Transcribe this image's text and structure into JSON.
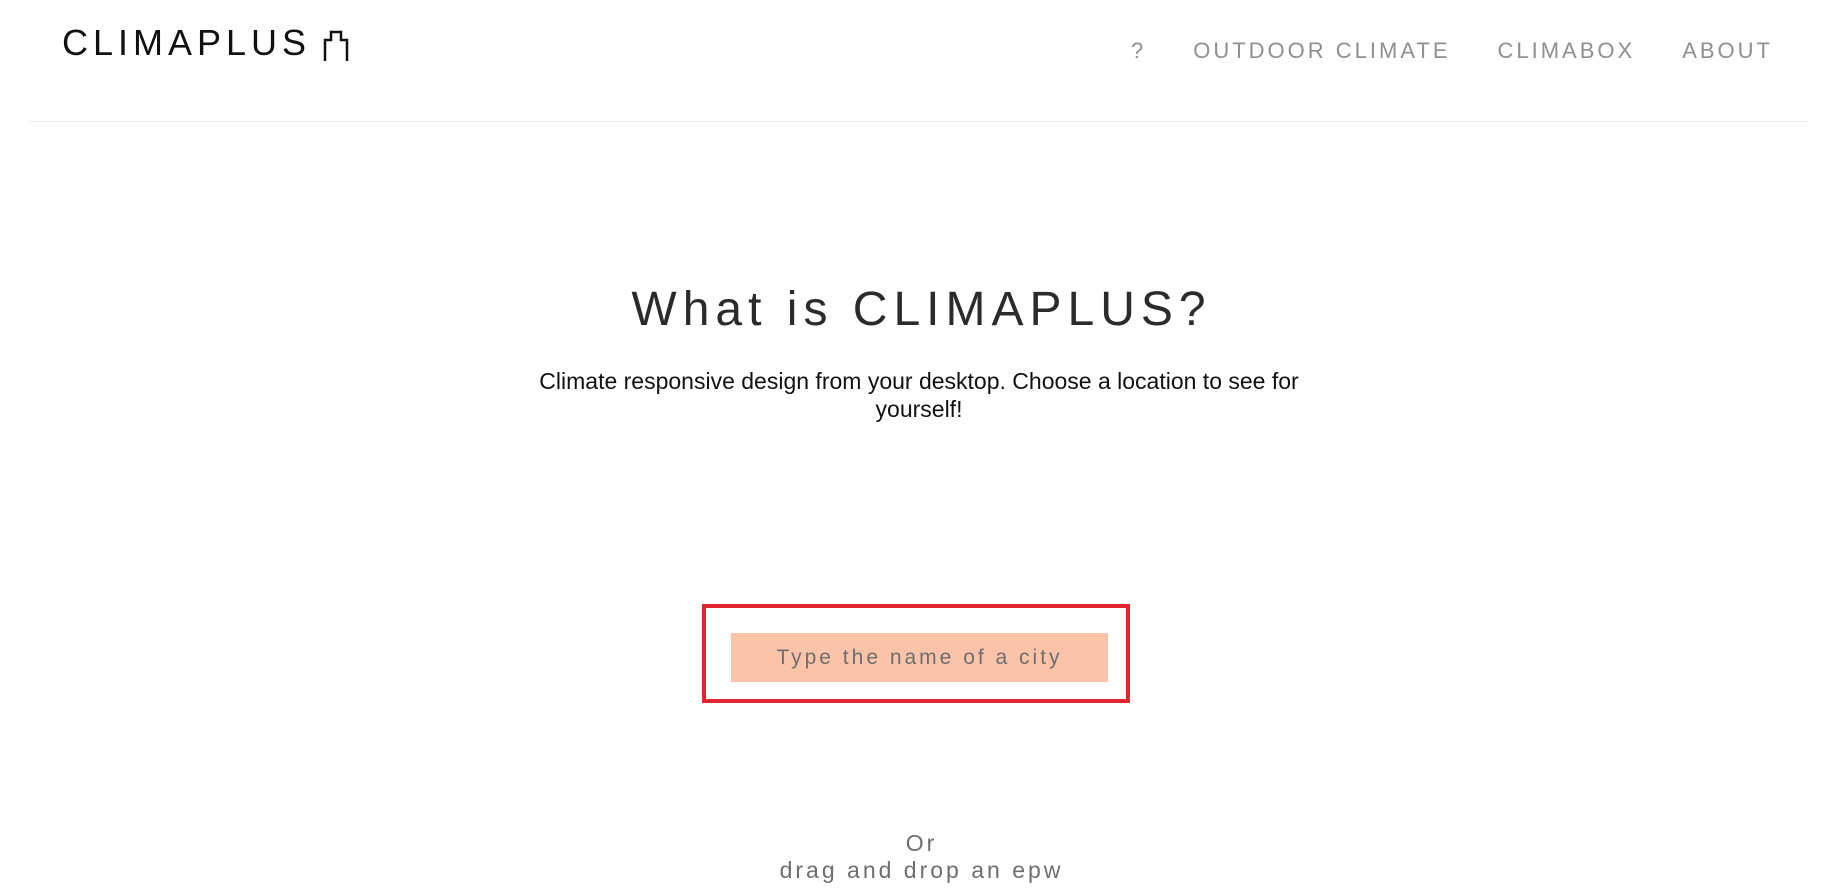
{
  "header": {
    "logo_text": "CLIMAPLUS",
    "logo_icon": "building-outline-icon",
    "nav": {
      "help": "?",
      "outdoor_climate": "OUTDOOR CLIMATE",
      "climabox": "CLIMABOX",
      "about": "ABOUT"
    }
  },
  "hero": {
    "title": "What is CLIMAPLUS?",
    "description": "Climate responsive design from your desktop. Choose a location to see for yourself!"
  },
  "search": {
    "placeholder": "Type the name of a city",
    "value": ""
  },
  "upload": {
    "or_label": "Or",
    "drag_label": "drag and drop an epw"
  },
  "colors": {
    "input_background": "#fbc3a8",
    "focus_outline": "#e0262f",
    "nav_text": "#8f8f8f"
  }
}
